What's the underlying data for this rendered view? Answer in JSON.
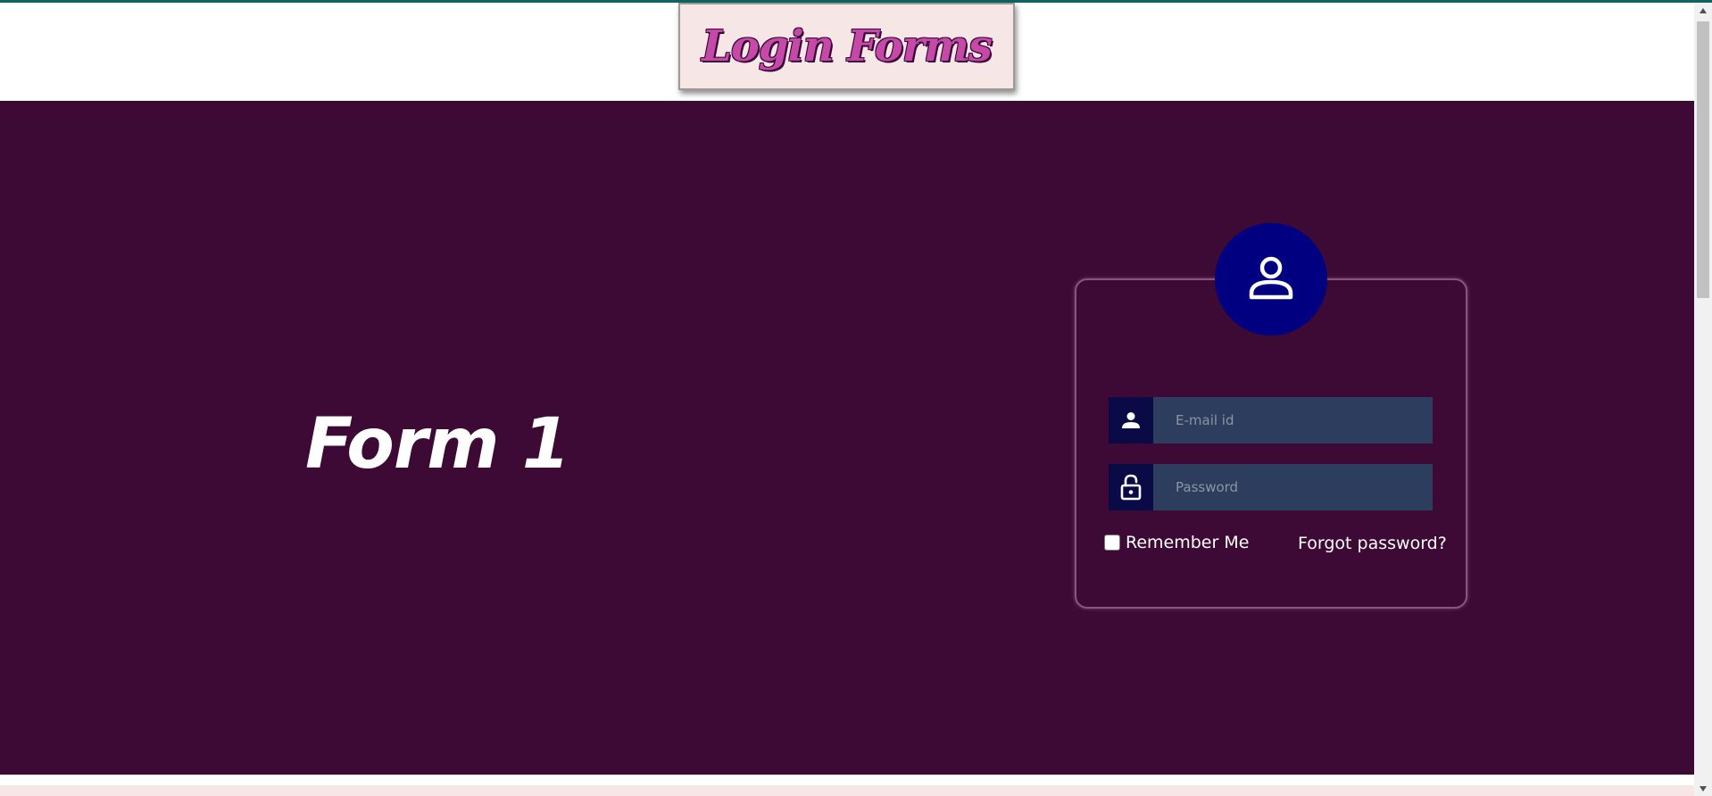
{
  "header": {
    "logo_text": "Login Forms"
  },
  "hero": {
    "title": "Form 1"
  },
  "login_form": {
    "email_placeholder": "E-mail id",
    "password_placeholder": "Password",
    "remember_label": "Remember Me",
    "forgot_label": "Forgot password?",
    "remember_checked": false
  },
  "icons": {
    "avatar": "user-outline-icon",
    "email_field": "user-icon",
    "password_field": "unlock-icon"
  },
  "colors": {
    "hero_background": "#3d0935",
    "logo_background": "#f7e6e6",
    "logo_text": "#c54aa8",
    "avatar_circle": "#010080",
    "field_background": "#2c3d5d",
    "field_icon_background": "#0a0a46",
    "top_line": "#0f6463"
  }
}
